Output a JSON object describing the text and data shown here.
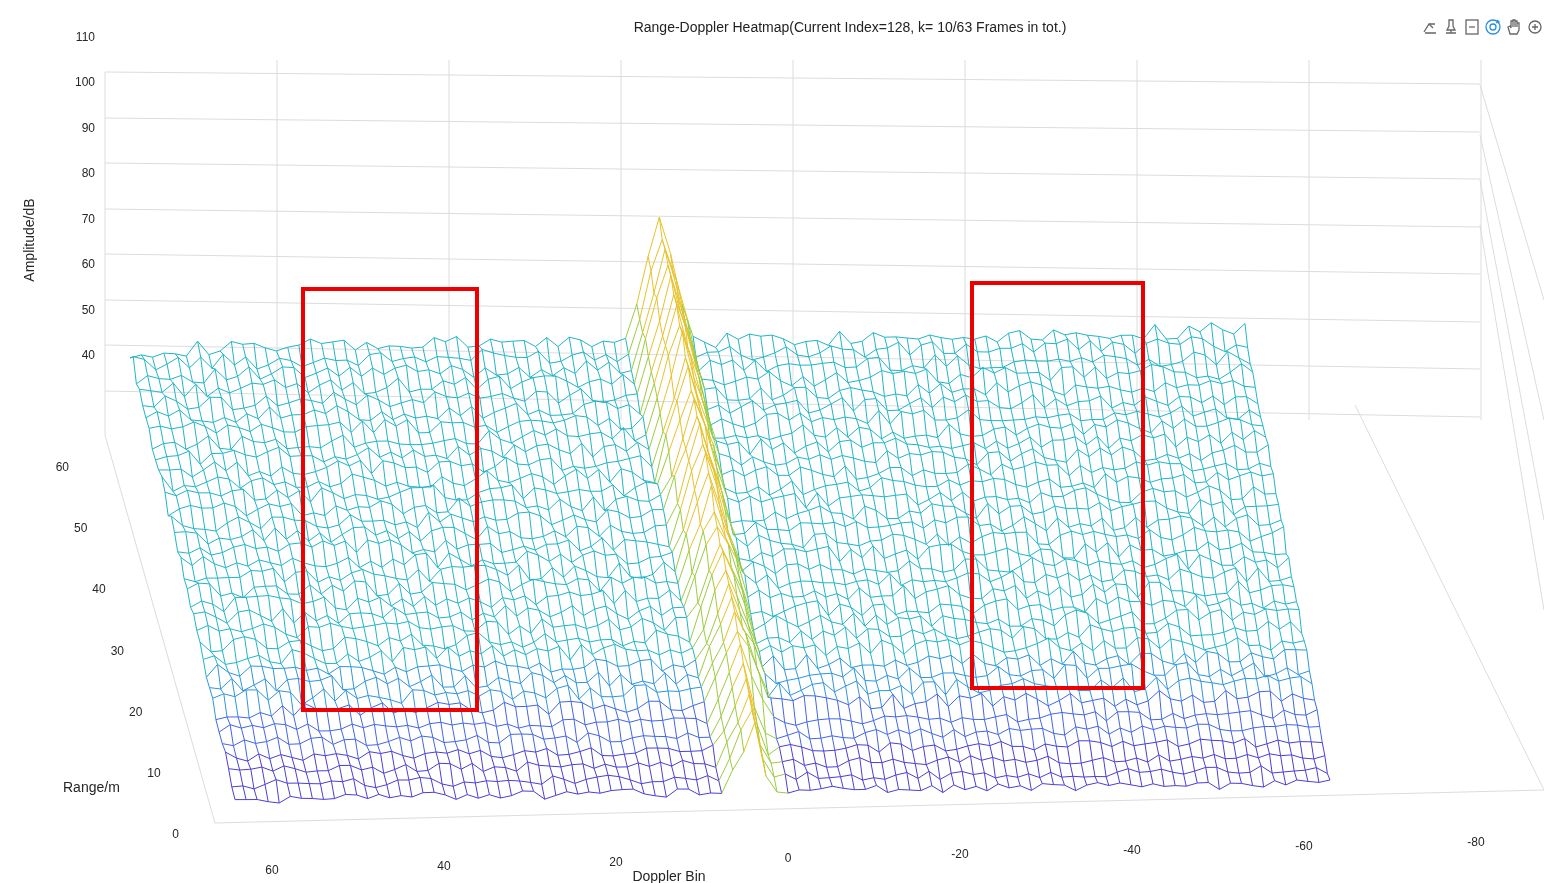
{
  "title": "Range-Doppler Heatmap(Current Index=128, k= 10/63 Frames in tot.)",
  "toolbar": [
    {
      "kind": "brush",
      "selected": false
    },
    {
      "kind": "pin",
      "selected": false
    },
    {
      "kind": "legend",
      "selected": false
    },
    {
      "kind": "rotate",
      "selected": true
    },
    {
      "kind": "pan",
      "selected": false
    },
    {
      "kind": "zoom",
      "selected": false
    }
  ],
  "z_axis": {
    "label": "Amplitude/dB",
    "ticks": [
      "110",
      "100",
      "90",
      "80",
      "70",
      "60",
      "50",
      "40"
    ]
  },
  "range_axis": {
    "label": "Range/m",
    "ticks": [
      "60",
      "50",
      "40",
      "30",
      "20",
      "10",
      "0"
    ]
  },
  "doppler_axis": {
    "label": "Doppler Bin",
    "ticks": [
      "60",
      "40",
      "20",
      "0",
      "-20",
      "-40",
      "-60",
      "-80"
    ]
  }
}
